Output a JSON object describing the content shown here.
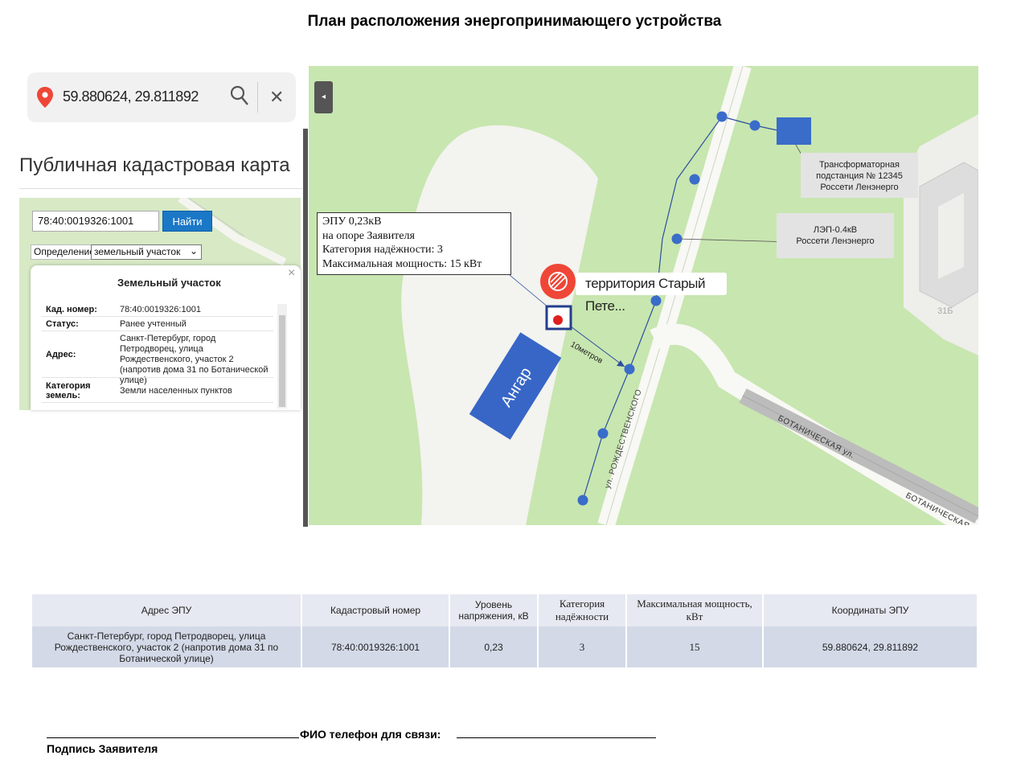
{
  "title": "План расположения энергопринимающего устройства",
  "search": {
    "coords": "59.880624, 29.811892"
  },
  "pkk": {
    "title": "Публичная кадастровая карта",
    "cad_input": "78:40:0019326:1001",
    "find_label": "Найти",
    "definition_label": "Определение:",
    "definition_value": "земельный участок",
    "card": {
      "title": "Земельный участок",
      "rows": [
        {
          "key": "Кад. номер:",
          "value": "78:40:0019326:1001"
        },
        {
          "key": "Статус:",
          "value": "Ранее учтенный"
        },
        {
          "key": "Адрес:",
          "value": "Санкт-Петербург, город Петродворец, улица Рождественского, участок 2 (напротив дома 31 по Ботанической улице)"
        },
        {
          "key": "Категория земель:",
          "value": "Земли населенных пунктов"
        }
      ]
    }
  },
  "map": {
    "epu_callout": [
      "ЭПУ 0,23кВ",
      "на опоре Заявителя",
      "Категория надёжности: 3",
      "Максимальная мощность:  15 кВт"
    ],
    "tp_label": [
      "Трансформаторная",
      "подстанция № 12345",
      "Россети Ленэнерго"
    ],
    "lep_label": [
      "ЛЭП-0.4кВ",
      "Россети Ленэнерго"
    ],
    "territory": "территория Старый Пете...",
    "hangar": "Ангар",
    "distance": "10метров",
    "street_rozhd": "ул. РОЖДЕСТВЕНСКОГО",
    "street_botan": "БОТАНИЧЕСКАЯ ул.",
    "street_botan2": "БОТАНИЧЕСКАЯ",
    "building_number": "31Б",
    "colors": {
      "green": "#c8e6b0",
      "road": "#f6f6f2",
      "pole": "#3a6cc9",
      "hangar": "#3766c6",
      "pin": "#ef4637"
    }
  },
  "table": {
    "headers": [
      "Адрес ЭПУ",
      "Кадастровый номер",
      "Уровень напряжения, кВ",
      "Категория надёжности",
      "Максимальная мощность, кВт",
      "Координаты ЭПУ"
    ],
    "row": {
      "address": "Санкт-Петербург, город Петродворец, улица Рождественского, участок 2 (напротив дома 31 по Ботанической улице)",
      "cadastral": "78:40:0019326:1001",
      "voltage": "0,23",
      "category": "3",
      "power": "15",
      "coords": "59.880624,  29.811892"
    }
  },
  "signature": {
    "fio": "ФИО  телефон для связи:",
    "label": "Подпись Заявителя"
  }
}
